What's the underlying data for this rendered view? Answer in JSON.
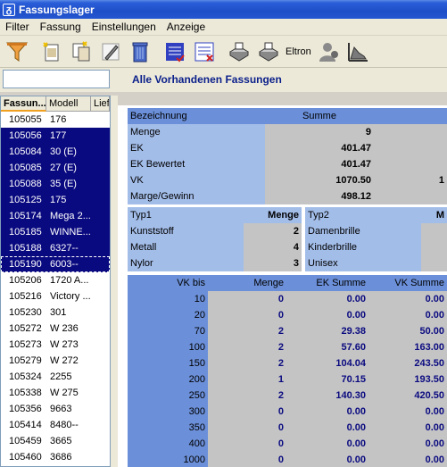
{
  "window": {
    "title": "Fassungslager"
  },
  "menu": [
    "Filter",
    "Fassung",
    "Einstellungen",
    "Anzeige"
  ],
  "toolbar": {
    "icons": [
      "filter-icon",
      "new-document-icon",
      "copy-document-icon",
      "edit-pen-icon",
      "delete-bin-icon",
      "list-icon",
      "list-delete-icon",
      "printer-icon",
      "printer-eltron-icon",
      "person-icon",
      "chart-icon"
    ],
    "eltron_label": "Eltron"
  },
  "search": {
    "value": ""
  },
  "heading": "Alle Vorhandenen Fassungen",
  "list": {
    "headers": [
      "Fassun...",
      "Modell",
      "Lief"
    ],
    "rows": [
      {
        "id": "105055",
        "model": "176",
        "sel": false
      },
      {
        "id": "105056",
        "model": "177",
        "sel": true
      },
      {
        "id": "105084",
        "model": "30 (E)",
        "sel": true
      },
      {
        "id": "105085",
        "model": "27 (E)",
        "sel": true
      },
      {
        "id": "105088",
        "model": "35 (E)",
        "sel": true
      },
      {
        "id": "105125",
        "model": "175",
        "sel": true
      },
      {
        "id": "105174",
        "model": "Mega 2...",
        "sel": true
      },
      {
        "id": "105185",
        "model": "WINNE...",
        "sel": true
      },
      {
        "id": "105188",
        "model": "6327--",
        "sel": true
      },
      {
        "id": "105190",
        "model": "6003--",
        "sel": true
      },
      {
        "id": "105206",
        "model": "1720 A...",
        "sel": false
      },
      {
        "id": "105216",
        "model": "Victory ...",
        "sel": false
      },
      {
        "id": "105230",
        "model": "301",
        "sel": false
      },
      {
        "id": "105272",
        "model": "W 236",
        "sel": false
      },
      {
        "id": "105273",
        "model": "W 273",
        "sel": false
      },
      {
        "id": "105279",
        "model": "W 272",
        "sel": false
      },
      {
        "id": "105324",
        "model": "2255",
        "sel": false
      },
      {
        "id": "105338",
        "model": "W 275",
        "sel": false
      },
      {
        "id": "105356",
        "model": "9663",
        "sel": false
      },
      {
        "id": "105414",
        "model": "8480--",
        "sel": false
      },
      {
        "id": "105459",
        "model": "3665",
        "sel": false
      },
      {
        "id": "105460",
        "model": "3686",
        "sel": false
      }
    ]
  },
  "summary": {
    "headers": [
      "Bezeichnung",
      "Summe"
    ],
    "rows": [
      {
        "label": "Menge",
        "value": "9",
        "extra": ""
      },
      {
        "label": "EK",
        "value": "401.47",
        "extra": ""
      },
      {
        "label": "EK Bewertet",
        "value": "401.47",
        "extra": ""
      },
      {
        "label": "VK",
        "value": "1070.50",
        "extra": "1"
      },
      {
        "label": "Marge/Gewinn",
        "value": "498.12",
        "extra": ""
      }
    ]
  },
  "typ1": {
    "headers": [
      "Typ1",
      "Menge"
    ],
    "rows": [
      {
        "label": "Kunststoff",
        "value": "2"
      },
      {
        "label": "Metall",
        "value": "4"
      },
      {
        "label": "Nylor",
        "value": "3"
      }
    ]
  },
  "typ2": {
    "headers": [
      "Typ2",
      "M"
    ],
    "rows": [
      {
        "label": "Damenbrille"
      },
      {
        "label": "Kinderbrille"
      },
      {
        "label": "Unisex"
      }
    ]
  },
  "vk": {
    "headers": [
      "VK bis",
      "Menge",
      "EK Summe",
      "VK Summe"
    ],
    "rows": [
      {
        "bis": "10",
        "menge": "0",
        "ek": "0.00",
        "vk": "0.00"
      },
      {
        "bis": "20",
        "menge": "0",
        "ek": "0.00",
        "vk": "0.00"
      },
      {
        "bis": "70",
        "menge": "2",
        "ek": "29.38",
        "vk": "50.00"
      },
      {
        "bis": "100",
        "menge": "2",
        "ek": "57.60",
        "vk": "163.00"
      },
      {
        "bis": "150",
        "menge": "2",
        "ek": "104.04",
        "vk": "243.50"
      },
      {
        "bis": "200",
        "menge": "1",
        "ek": "70.15",
        "vk": "193.50"
      },
      {
        "bis": "250",
        "menge": "2",
        "ek": "140.30",
        "vk": "420.50"
      },
      {
        "bis": "300",
        "menge": "0",
        "ek": "0.00",
        "vk": "0.00"
      },
      {
        "bis": "350",
        "menge": "0",
        "ek": "0.00",
        "vk": "0.00"
      },
      {
        "bis": "400",
        "menge": "0",
        "ek": "0.00",
        "vk": "0.00"
      },
      {
        "bis": "1000",
        "menge": "0",
        "ek": "0.00",
        "vk": "0.00"
      }
    ]
  }
}
